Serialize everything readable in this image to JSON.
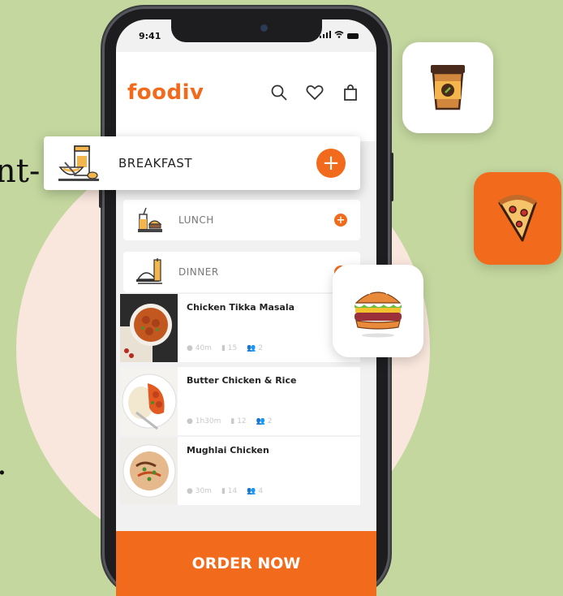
{
  "background_text": {
    "line1": "nt-",
    "line2": "."
  },
  "colors": {
    "accent": "#f26a1b",
    "page_bg": "#c4d79f",
    "blob": "#f9e7dd"
  },
  "status_bar": {
    "time": "9:41"
  },
  "app": {
    "brand": "foodiv"
  },
  "header_icons": [
    "search-icon",
    "heart-icon",
    "bag-icon"
  ],
  "categories": {
    "breakfast": "BREAKFAST",
    "lunch": "LUNCH",
    "dinner": "DINNER"
  },
  "recipes": [
    {
      "name": "Chicken Tikka Masala",
      "time": "40m",
      "steps": "15",
      "serves": "2"
    },
    {
      "name": "Butter Chicken & Rice",
      "time": "1h30m",
      "steps": "12",
      "serves": "2"
    },
    {
      "name": "Mughlai Chicken",
      "time": "30m",
      "steps": "14",
      "serves": "4"
    }
  ],
  "cta": {
    "order_label": "ORDER NOW"
  },
  "floating_icons": [
    "coffee-cup-icon",
    "pizza-icon",
    "burger-icon"
  ]
}
